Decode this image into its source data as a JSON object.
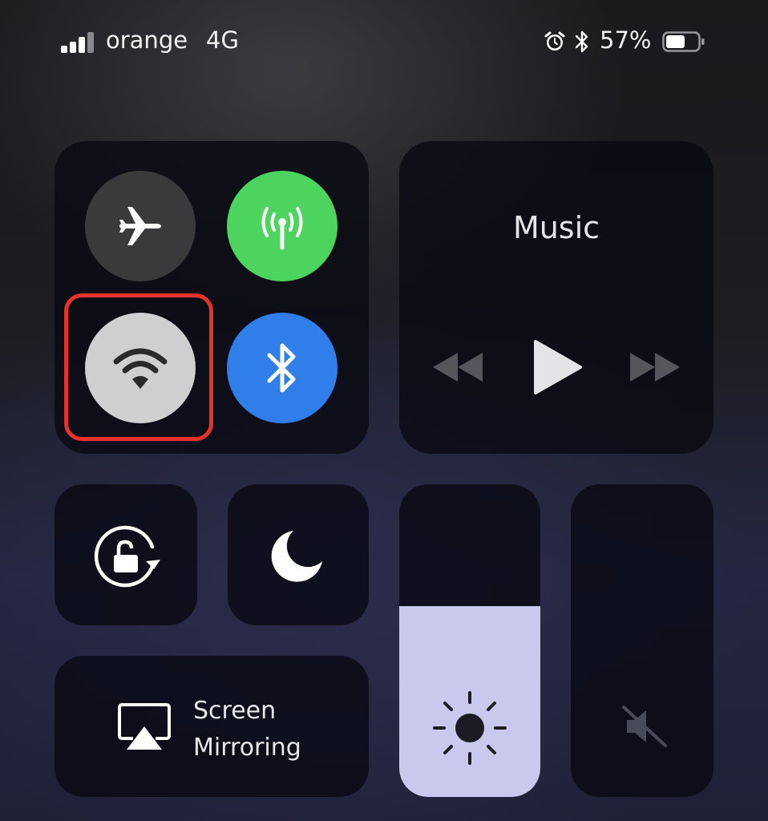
{
  "status_bar": {
    "carrier": "orange",
    "network": "4G",
    "signal_bars": 4,
    "signal_bars_active": 3,
    "battery_percent": "57%",
    "battery_level": 0.57,
    "icons": [
      "alarm-icon",
      "bluetooth-icon",
      "battery-icon"
    ]
  },
  "connectivity": {
    "airplane_mode": {
      "icon": "airplane-icon",
      "on": false
    },
    "cellular_data": {
      "icon": "cellular-antenna-icon",
      "on": true,
      "color": "#4cd45f"
    },
    "wifi": {
      "icon": "wifi-icon",
      "on": false,
      "highlighted": true
    },
    "bluetooth": {
      "icon": "bluetooth-icon",
      "on": true,
      "color": "#2f7ee9"
    }
  },
  "music": {
    "title": "Music",
    "controls": [
      "rewind-icon",
      "play-icon",
      "fast-forward-icon"
    ]
  },
  "orientation_lock": {
    "icon": "rotation-lock-icon"
  },
  "do_not_disturb": {
    "icon": "moon-icon"
  },
  "screen_mirroring": {
    "line1": "Screen",
    "line2": "Mirroring",
    "icon": "airplay-icon"
  },
  "brightness": {
    "icon": "sun-icon",
    "level": 0.61,
    "fill_color": "#c9c9ee"
  },
  "volume": {
    "icon": "speaker-muted-icon",
    "level": 0
  },
  "colors": {
    "highlight_border": "#e5322b",
    "panel_bg": "#0a0a14"
  }
}
